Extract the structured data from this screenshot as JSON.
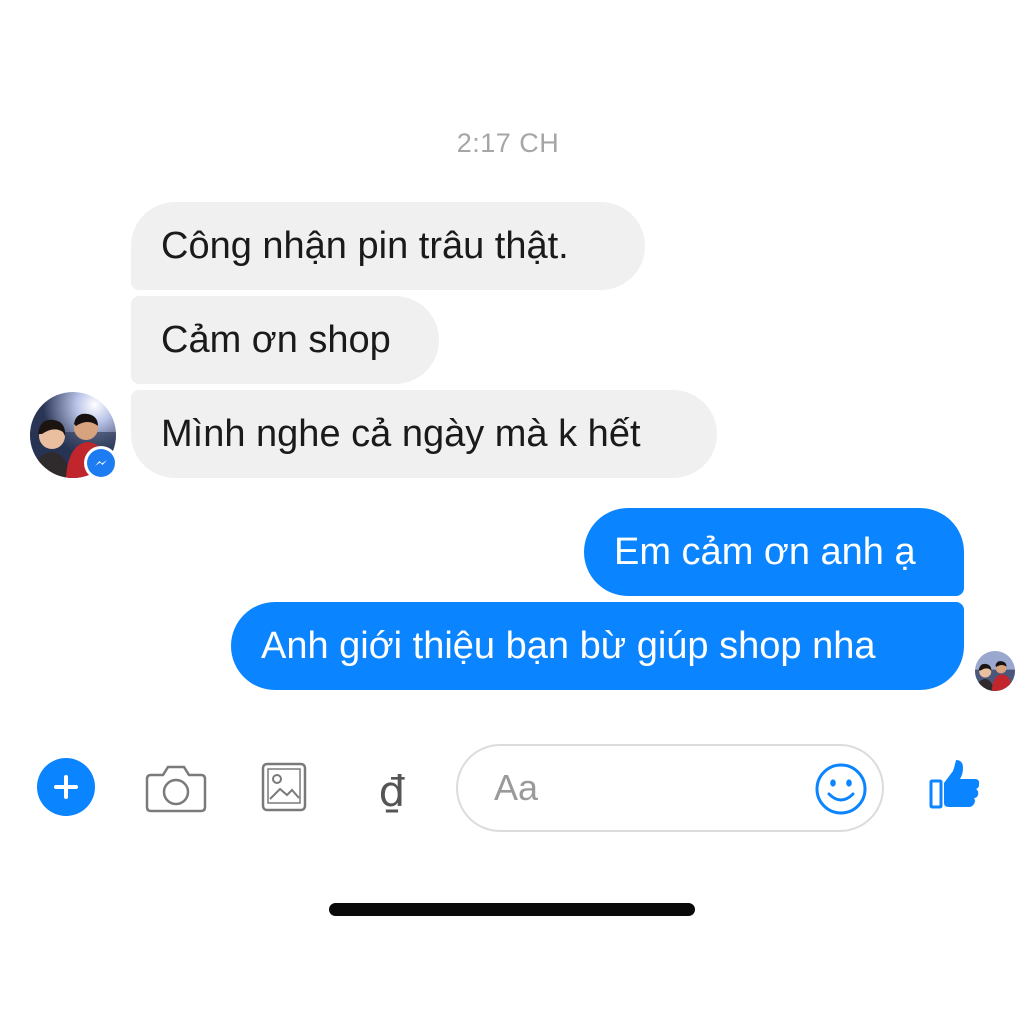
{
  "conversation": {
    "timestamp": "2:17 CH",
    "messages": [
      {
        "direction": "incoming",
        "text": "Công nhận pin trâu thật."
      },
      {
        "direction": "incoming",
        "text": "Cảm ơn shop"
      },
      {
        "direction": "incoming",
        "text": "Mình nghe cả ngày mà k hết"
      },
      {
        "direction": "outgoing",
        "text": "Em cảm ơn anh ạ"
      },
      {
        "direction": "outgoing",
        "text": "Anh giới thiệu bạn bừ giúp shop nha"
      }
    ]
  },
  "composer": {
    "input_placeholder": "Aa",
    "currency_symbol": "₫",
    "icons": [
      "plus-icon",
      "camera-icon",
      "gallery-icon",
      "currency-icon",
      "emoji-icon",
      "thumbs-up-icon"
    ]
  },
  "colors": {
    "accent": "#0b84ff",
    "incoming_bubble": "#f0f0f0",
    "timestamp_text": "#a6a6a6"
  }
}
